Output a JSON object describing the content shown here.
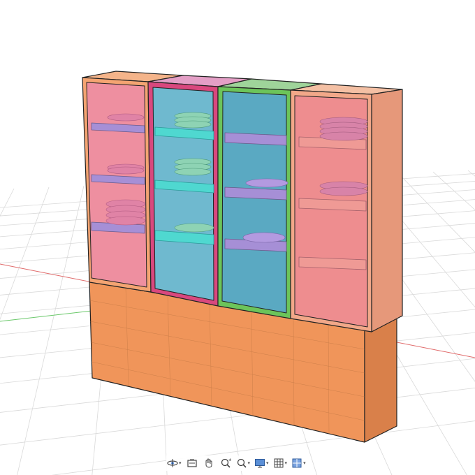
{
  "scene": {
    "background": "#ffffff",
    "grid_color": "#d9d9d9",
    "axis_x_color": "#e06a6a",
    "axis_y_color": "#6ac86a",
    "base_color": "#f0955a",
    "cabinet_colors": {
      "left": "#f4a472",
      "left_glass": "#ee8fa0",
      "center_left_frame": "#d9487e",
      "center_left_glass": "#6fb9cf",
      "center_right_frame": "#6cc45a",
      "center_right_glass": "#5aa9c2",
      "right": "#f2a889",
      "right_glass": "#ee8d8f",
      "shelf_purple": "#a68fd6",
      "shelf_cyan": "#4fd8d0",
      "plate_pink": "#e083a6",
      "plate_green": "#8ed3b4"
    }
  },
  "toolbar": {
    "buttons": [
      {
        "icon": "orbit-icon",
        "has_dropdown": true
      },
      {
        "icon": "look-at-icon",
        "has_dropdown": false
      },
      {
        "icon": "pan-hand-icon",
        "has_dropdown": false
      },
      {
        "icon": "zoom-icon",
        "has_dropdown": false
      },
      {
        "icon": "zoom-window-icon",
        "has_dropdown": true
      },
      {
        "icon": "display-settings-icon",
        "has_dropdown": true
      },
      {
        "icon": "grid-settings-icon",
        "has_dropdown": true
      },
      {
        "icon": "viewports-icon",
        "has_dropdown": true
      }
    ]
  }
}
